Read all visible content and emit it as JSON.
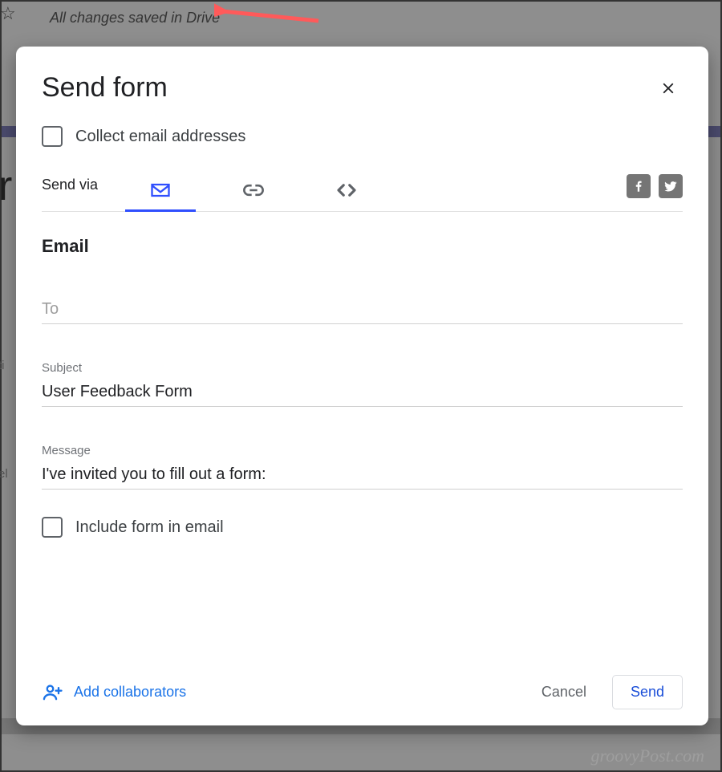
{
  "background": {
    "saved_text": "All changes saved in Drive",
    "form_letter_fragment": "r",
    "fragment_ti": "ti",
    "fragment_el": "el",
    "watermark": "groovyPost.com"
  },
  "dialog": {
    "title": "Send form",
    "collect_email_label": "Collect email addresses",
    "send_via_label": "Send via",
    "section_title": "Email",
    "to": {
      "label": "To",
      "value": ""
    },
    "subject": {
      "label": "Subject",
      "value": "User Feedback Form"
    },
    "message": {
      "label": "Message",
      "value": "I've invited you to fill out a form:"
    },
    "include_form_label": "Include form in email",
    "add_collaborators_label": "Add collaborators",
    "cancel_label": "Cancel",
    "send_label": "Send"
  }
}
